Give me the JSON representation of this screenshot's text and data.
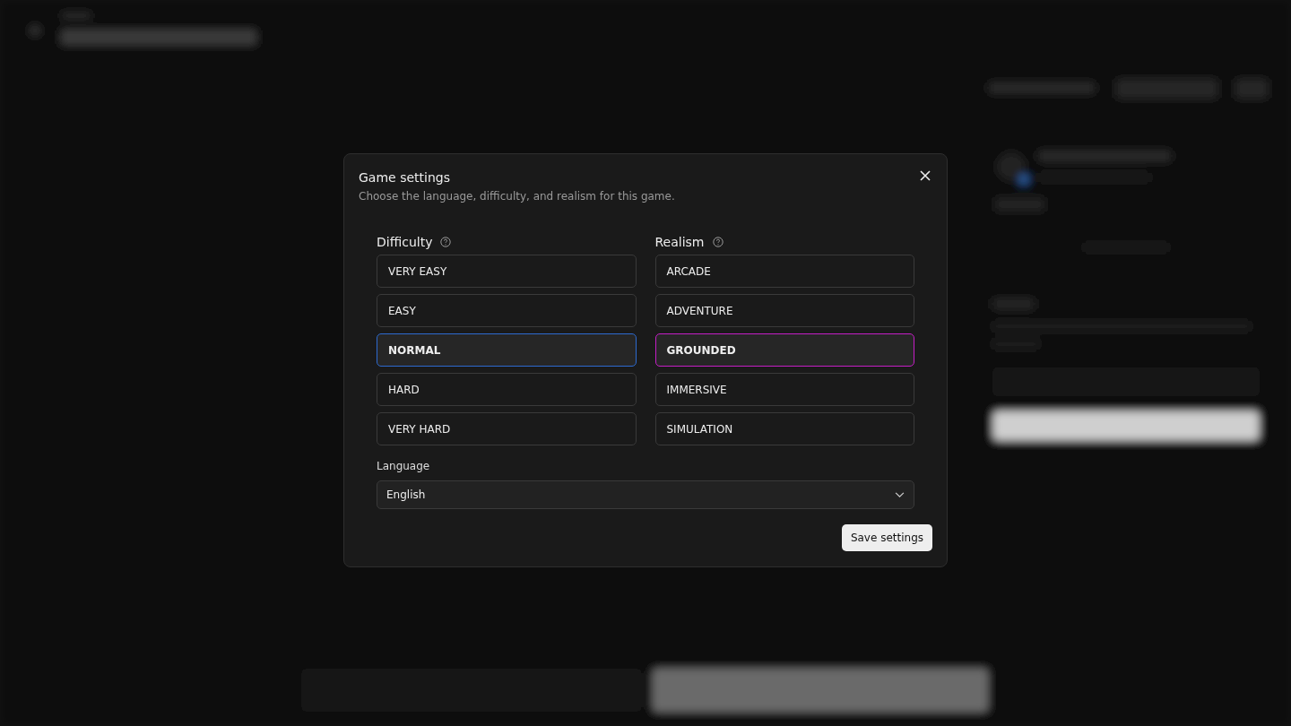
{
  "dialog": {
    "title": "Game settings",
    "description": "Choose the language, difficulty, and realism for this game.",
    "groups": [
      {
        "kind": "difficulty",
        "label": "Difficulty",
        "options": [
          {
            "label": "VERY EASY",
            "selected": false
          },
          {
            "label": "EASY",
            "selected": false
          },
          {
            "label": "NORMAL",
            "selected": true
          },
          {
            "label": "HARD",
            "selected": false
          },
          {
            "label": "VERY HARD",
            "selected": false
          }
        ]
      },
      {
        "kind": "realism",
        "label": "Realism",
        "options": [
          {
            "label": "ARCADE",
            "selected": false
          },
          {
            "label": "ADVENTURE",
            "selected": false
          },
          {
            "label": "GROUNDED",
            "selected": true
          },
          {
            "label": "IMMERSIVE",
            "selected": false
          },
          {
            "label": "SIMULATION",
            "selected": false
          }
        ]
      }
    ],
    "language": {
      "label": "Language",
      "value": "English"
    },
    "save_button": "Save settings"
  }
}
